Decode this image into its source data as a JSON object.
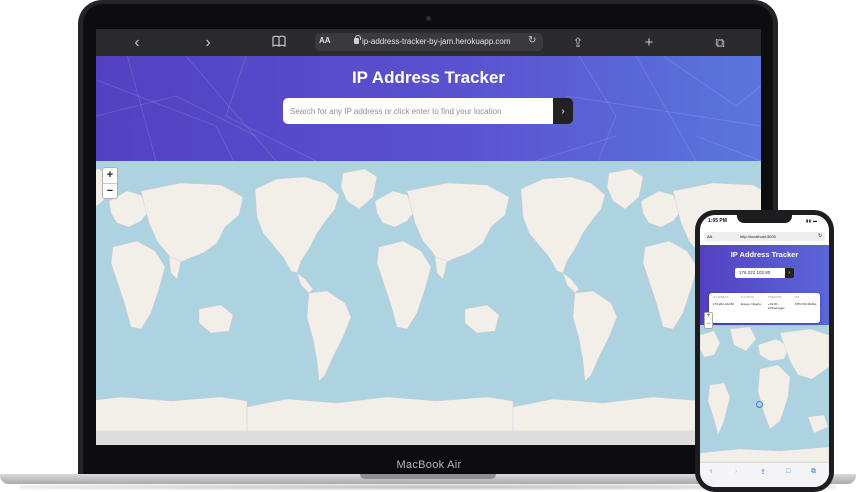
{
  "macbook": {
    "label": "MacBook Air"
  },
  "browser": {
    "back_icon": "chevron-left-icon",
    "back_glyph": "‹",
    "forward_icon": "chevron-right-icon",
    "forward_glyph": "›",
    "bookmarks_icon": "book-icon",
    "text_size": "AA",
    "url": "ip-address-tracker-by-jam.herokuapp.com",
    "reload_glyph": "↻",
    "share_icon": "share-icon",
    "share_glyph": "⇪",
    "new_tab_glyph": "+",
    "tabs_icon": "tabs-icon",
    "tabs_glyph": "⧉"
  },
  "app": {
    "title": "IP Address Tracker",
    "search_placeholder": "Search for any IP address or click enter to find your location",
    "search_button_glyph": "›",
    "zoom_in": "+",
    "zoom_out": "−"
  },
  "phone": {
    "time": "1:05 PM",
    "text_size": "AA",
    "url": "http://localhost:3000",
    "reload_glyph": "↻",
    "title": "IP Address Tracker",
    "search_value": "176.222.102.80",
    "search_button_glyph": "›",
    "card": [
      {
        "label": "IP ADDRESS",
        "value": "176.222.102.80"
      },
      {
        "label": "LOCATION",
        "value": "Enugu, Nigeria"
      },
      {
        "label": "TIMEZONE",
        "value": "+01:00 - Africa/Lagos"
      },
      {
        "label": "ISP",
        "value": "MTN NG Mobile"
      }
    ],
    "zoom_in": "+",
    "zoom_out": "−",
    "bottom_glyphs": [
      "‹",
      "›",
      "⇪",
      "□",
      "⧉"
    ]
  },
  "colors": {
    "header_start": "#5341c2",
    "header_end": "#5a76de",
    "ocean": "#acd3df",
    "land": "#f2efe9"
  }
}
